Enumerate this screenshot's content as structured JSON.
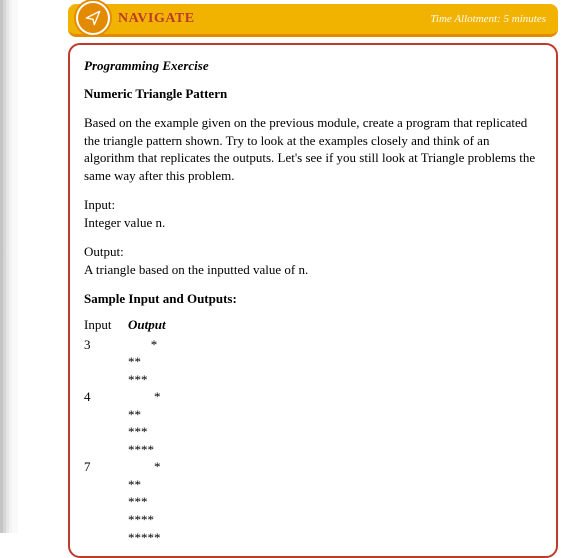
{
  "nav": {
    "icon": "paper-plane-icon",
    "title": "NAVIGATE",
    "time": "Time Allotment: 5 minutes"
  },
  "exercise": {
    "section_label": "Programming Exercise",
    "title": "Numeric Triangle Pattern",
    "description": "Based on the example given on the previous module, create a program that replicated the triangle pattern shown. Try to look at the examples closely and think of an algorithm that replicates the outputs. Let's see if you still look at Triangle problems the same way after this problem.",
    "input_label": "Input:",
    "input_text": "Integer value n.",
    "output_label": "Output:",
    "output_text": "A triangle based on the inputted value of n.",
    "sample_heading": "Sample Input and Outputs:",
    "table": {
      "col_input": "Input",
      "col_output": "Output",
      "rows": [
        {
          "input": "3",
          "output": "       *\n**\n***"
        },
        {
          "input": "4",
          "output": "        *\n**\n***\n****"
        },
        {
          "input": "7",
          "output": "        *\n**\n***\n****\n*****"
        }
      ]
    }
  }
}
